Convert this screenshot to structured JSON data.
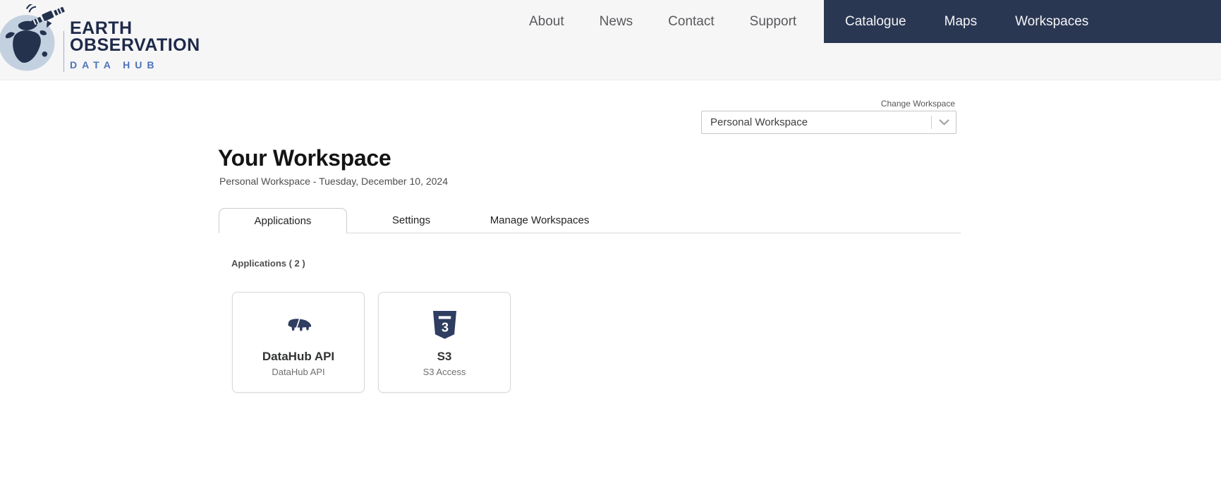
{
  "brand": {
    "line1": "EARTH",
    "line2": "OBSERVATION",
    "line3": "DATA HUB"
  },
  "nav": {
    "light_items": [
      {
        "label": "About"
      },
      {
        "label": "News"
      },
      {
        "label": "Contact"
      },
      {
        "label": "Support"
      }
    ],
    "dark_items": [
      {
        "label": "Catalogue"
      },
      {
        "label": "Maps"
      },
      {
        "label": "Workspaces"
      }
    ]
  },
  "workspace_selector": {
    "label": "Change Workspace",
    "selected": "Personal Workspace"
  },
  "page": {
    "title": "Your Workspace",
    "subtitle": "Personal Workspace - Tuesday, December 10, 2024"
  },
  "tabs": [
    {
      "label": "Applications",
      "active": true
    },
    {
      "label": "Settings",
      "active": false
    },
    {
      "label": "Manage Workspaces",
      "active": false
    }
  ],
  "applications": {
    "count_label": "Applications ( 2 )",
    "cards": [
      {
        "title": "DataHub API",
        "subtitle": "DataHub API",
        "icon": "tapir-icon"
      },
      {
        "title": "S3",
        "subtitle": "S3 Access",
        "icon": "s3-shield-icon"
      }
    ]
  },
  "colors": {
    "nav_dark_bg": "#2a3752",
    "brand_navy": "#1e2a49",
    "brand_blue": "#4d73b8",
    "icon_navy": "#2e3d60",
    "header_bg": "#f6f6f7",
    "text_gray": "#58595b"
  }
}
